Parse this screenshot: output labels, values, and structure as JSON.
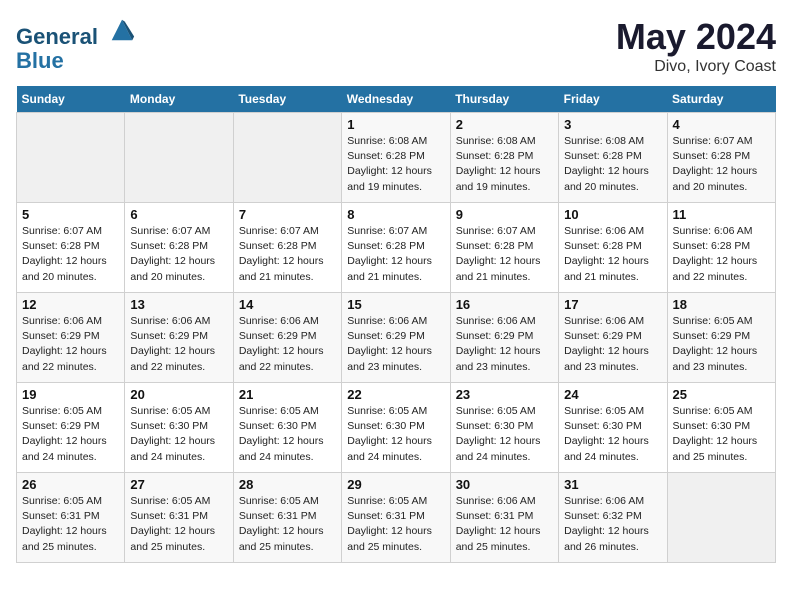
{
  "logo": {
    "line1": "General",
    "line2": "Blue"
  },
  "calendar": {
    "title": "May 2024",
    "location": "Divo, Ivory Coast"
  },
  "days_of_week": [
    "Sunday",
    "Monday",
    "Tuesday",
    "Wednesday",
    "Thursday",
    "Friday",
    "Saturday"
  ],
  "weeks": [
    [
      {
        "day": "",
        "info": ""
      },
      {
        "day": "",
        "info": ""
      },
      {
        "day": "",
        "info": ""
      },
      {
        "day": "1",
        "info": "Sunrise: 6:08 AM\nSunset: 6:28 PM\nDaylight: 12 hours\nand 19 minutes."
      },
      {
        "day": "2",
        "info": "Sunrise: 6:08 AM\nSunset: 6:28 PM\nDaylight: 12 hours\nand 19 minutes."
      },
      {
        "day": "3",
        "info": "Sunrise: 6:08 AM\nSunset: 6:28 PM\nDaylight: 12 hours\nand 20 minutes."
      },
      {
        "day": "4",
        "info": "Sunrise: 6:07 AM\nSunset: 6:28 PM\nDaylight: 12 hours\nand 20 minutes."
      }
    ],
    [
      {
        "day": "5",
        "info": "Sunrise: 6:07 AM\nSunset: 6:28 PM\nDaylight: 12 hours\nand 20 minutes."
      },
      {
        "day": "6",
        "info": "Sunrise: 6:07 AM\nSunset: 6:28 PM\nDaylight: 12 hours\nand 20 minutes."
      },
      {
        "day": "7",
        "info": "Sunrise: 6:07 AM\nSunset: 6:28 PM\nDaylight: 12 hours\nand 21 minutes."
      },
      {
        "day": "8",
        "info": "Sunrise: 6:07 AM\nSunset: 6:28 PM\nDaylight: 12 hours\nand 21 minutes."
      },
      {
        "day": "9",
        "info": "Sunrise: 6:07 AM\nSunset: 6:28 PM\nDaylight: 12 hours\nand 21 minutes."
      },
      {
        "day": "10",
        "info": "Sunrise: 6:06 AM\nSunset: 6:28 PM\nDaylight: 12 hours\nand 21 minutes."
      },
      {
        "day": "11",
        "info": "Sunrise: 6:06 AM\nSunset: 6:28 PM\nDaylight: 12 hours\nand 22 minutes."
      }
    ],
    [
      {
        "day": "12",
        "info": "Sunrise: 6:06 AM\nSunset: 6:29 PM\nDaylight: 12 hours\nand 22 minutes."
      },
      {
        "day": "13",
        "info": "Sunrise: 6:06 AM\nSunset: 6:29 PM\nDaylight: 12 hours\nand 22 minutes."
      },
      {
        "day": "14",
        "info": "Sunrise: 6:06 AM\nSunset: 6:29 PM\nDaylight: 12 hours\nand 22 minutes."
      },
      {
        "day": "15",
        "info": "Sunrise: 6:06 AM\nSunset: 6:29 PM\nDaylight: 12 hours\nand 23 minutes."
      },
      {
        "day": "16",
        "info": "Sunrise: 6:06 AM\nSunset: 6:29 PM\nDaylight: 12 hours\nand 23 minutes."
      },
      {
        "day": "17",
        "info": "Sunrise: 6:06 AM\nSunset: 6:29 PM\nDaylight: 12 hours\nand 23 minutes."
      },
      {
        "day": "18",
        "info": "Sunrise: 6:05 AM\nSunset: 6:29 PM\nDaylight: 12 hours\nand 23 minutes."
      }
    ],
    [
      {
        "day": "19",
        "info": "Sunrise: 6:05 AM\nSunset: 6:29 PM\nDaylight: 12 hours\nand 24 minutes."
      },
      {
        "day": "20",
        "info": "Sunrise: 6:05 AM\nSunset: 6:30 PM\nDaylight: 12 hours\nand 24 minutes."
      },
      {
        "day": "21",
        "info": "Sunrise: 6:05 AM\nSunset: 6:30 PM\nDaylight: 12 hours\nand 24 minutes."
      },
      {
        "day": "22",
        "info": "Sunrise: 6:05 AM\nSunset: 6:30 PM\nDaylight: 12 hours\nand 24 minutes."
      },
      {
        "day": "23",
        "info": "Sunrise: 6:05 AM\nSunset: 6:30 PM\nDaylight: 12 hours\nand 24 minutes."
      },
      {
        "day": "24",
        "info": "Sunrise: 6:05 AM\nSunset: 6:30 PM\nDaylight: 12 hours\nand 24 minutes."
      },
      {
        "day": "25",
        "info": "Sunrise: 6:05 AM\nSunset: 6:30 PM\nDaylight: 12 hours\nand 25 minutes."
      }
    ],
    [
      {
        "day": "26",
        "info": "Sunrise: 6:05 AM\nSunset: 6:31 PM\nDaylight: 12 hours\nand 25 minutes."
      },
      {
        "day": "27",
        "info": "Sunrise: 6:05 AM\nSunset: 6:31 PM\nDaylight: 12 hours\nand 25 minutes."
      },
      {
        "day": "28",
        "info": "Sunrise: 6:05 AM\nSunset: 6:31 PM\nDaylight: 12 hours\nand 25 minutes."
      },
      {
        "day": "29",
        "info": "Sunrise: 6:05 AM\nSunset: 6:31 PM\nDaylight: 12 hours\nand 25 minutes."
      },
      {
        "day": "30",
        "info": "Sunrise: 6:06 AM\nSunset: 6:31 PM\nDaylight: 12 hours\nand 25 minutes."
      },
      {
        "day": "31",
        "info": "Sunrise: 6:06 AM\nSunset: 6:32 PM\nDaylight: 12 hours\nand 26 minutes."
      },
      {
        "day": "",
        "info": ""
      }
    ]
  ]
}
